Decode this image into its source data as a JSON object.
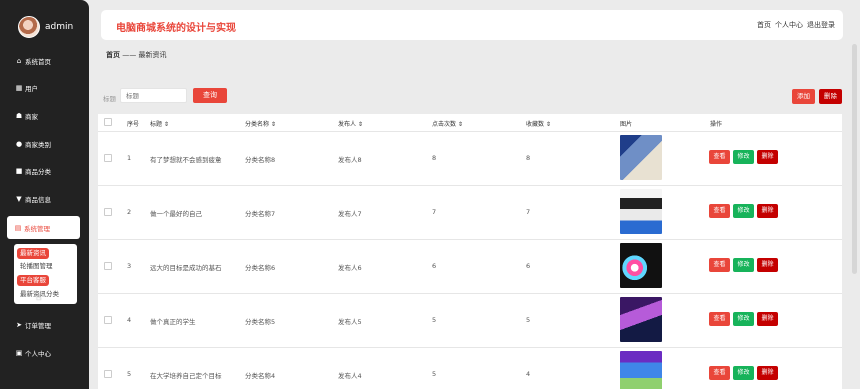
{
  "user": {
    "name": "admin"
  },
  "sidebar": {
    "items": [
      {
        "label": "系统首页",
        "icon": "home-icon",
        "glyph": "⌂"
      },
      {
        "label": "用户",
        "icon": "grid-icon",
        "glyph": "▦"
      },
      {
        "label": "商家",
        "icon": "shop-icon",
        "glyph": "☗"
      },
      {
        "label": "商家类别",
        "icon": "person-icon",
        "glyph": "●"
      },
      {
        "label": "商品分类",
        "icon": "box-icon",
        "glyph": "■"
      },
      {
        "label": "商品信息",
        "icon": "pin-icon",
        "glyph": "▼"
      },
      {
        "label": "系统管理",
        "icon": "list-icon",
        "glyph": "▤"
      },
      {
        "label": "订单管理",
        "icon": "send-icon",
        "glyph": "➤"
      },
      {
        "label": "个人中心",
        "icon": "window-icon",
        "glyph": "▣"
      }
    ],
    "submenu": [
      "最新资讯",
      "轮播图管理",
      "平台客服",
      "最新资讯分类"
    ]
  },
  "header": {
    "title": "电脑商城系统的设计与实现",
    "links": [
      "首页",
      "个人中心",
      "退出登录"
    ]
  },
  "breadcrumb": {
    "home": "首页",
    "sep": "——",
    "current": "最新资讯"
  },
  "search": {
    "label": "标题",
    "placeholder": "标题",
    "button": "查询"
  },
  "actions": {
    "add": "添加",
    "delete": "删除"
  },
  "table": {
    "columns": [
      "序号",
      "标题 ⇕",
      "分类名称 ⇕",
      "发布人 ⇕",
      "点击次数 ⇕",
      "收藏数 ⇕",
      "图片",
      "操作"
    ],
    "ops": {
      "view": "查看",
      "edit": "修改",
      "delete": "删除"
    },
    "rows": [
      {
        "no": "1",
        "title": "有了梦想就不会感到疲惫",
        "category": "分类名称8",
        "author": "发布人8",
        "clicks": "8",
        "favs": "8",
        "thumb": "t1"
      },
      {
        "no": "2",
        "title": "做一个最好的自己",
        "category": "分类名称7",
        "author": "发布人7",
        "clicks": "7",
        "favs": "7",
        "thumb": "t2"
      },
      {
        "no": "3",
        "title": "远大的目标是成功的基石",
        "category": "分类名称6",
        "author": "发布人6",
        "clicks": "6",
        "favs": "6",
        "thumb": "t3"
      },
      {
        "no": "4",
        "title": "做个真正的学生",
        "category": "分类名称5",
        "author": "发布人5",
        "clicks": "5",
        "favs": "5",
        "thumb": "t4"
      },
      {
        "no": "5",
        "title": "在大学培养自己定个目标",
        "category": "分类名称4",
        "author": "发布人4",
        "clicks": "5",
        "favs": "4",
        "thumb": "t5"
      }
    ]
  },
  "colors": {
    "accent": "#e9463a",
    "danger": "#c40000",
    "success": "#17b35a",
    "sidebar": "#222222"
  }
}
